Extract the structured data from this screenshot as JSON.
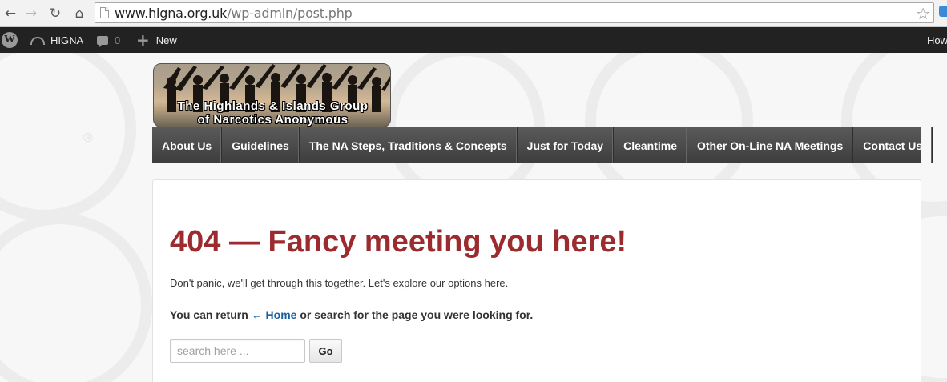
{
  "browser": {
    "url_domain": "www.higna.org.uk",
    "url_path": "/wp-admin/post.php"
  },
  "adminbar": {
    "site_name": "HIGNA",
    "comment_count": "0",
    "new_label": "New",
    "howdy": "How"
  },
  "header": {
    "logo_line1": "The Highlands & Islands Group",
    "logo_line2": "of Narcotics Anonymous"
  },
  "nav": {
    "items": [
      {
        "label": "About Us"
      },
      {
        "label": "Guidelines"
      },
      {
        "label": "The NA Steps, Traditions & Concepts"
      },
      {
        "label": "Just for Today"
      },
      {
        "label": "Cleantime"
      },
      {
        "label": "Other On-Line NA Meetings"
      },
      {
        "label": "Contact Us"
      }
    ]
  },
  "main": {
    "heading": "404 — Fancy meeting you here!",
    "intro": "Don't panic, we'll get through this together. Let's explore our options here.",
    "return_prefix": "You can return ",
    "home_link": "← Home",
    "return_suffix": " or search for the page you were looking for.",
    "search_placeholder": "search here ...",
    "go_label": "Go"
  },
  "colors": {
    "heading": "#9b2b2f",
    "link": "#1a5f9e",
    "adminbar": "#222222",
    "nav": "#4a4a4a"
  }
}
